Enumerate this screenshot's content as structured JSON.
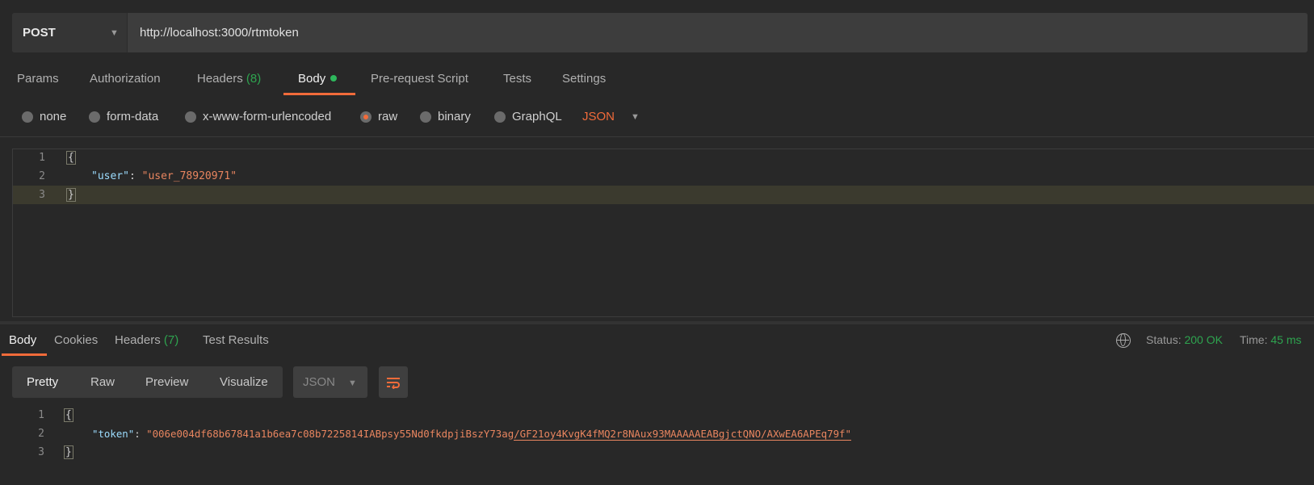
{
  "request": {
    "method": "POST",
    "url": "http://localhost:3000/rtmtoken"
  },
  "tabs": [
    {
      "label": "Params"
    },
    {
      "label": "Authorization"
    },
    {
      "label": "Headers",
      "count": "(8)"
    },
    {
      "label": "Body",
      "active": true
    },
    {
      "label": "Pre-request Script"
    },
    {
      "label": "Tests"
    },
    {
      "label": "Settings"
    }
  ],
  "body_types": [
    {
      "label": "none"
    },
    {
      "label": "form-data"
    },
    {
      "label": "x-www-form-urlencoded"
    },
    {
      "label": "raw",
      "selected": true
    },
    {
      "label": "binary"
    },
    {
      "label": "GraphQL"
    }
  ],
  "format": "JSON",
  "request_body": {
    "lines": [
      "1",
      "2",
      "3"
    ],
    "open": "{",
    "key": "\"user\"",
    "colon": ": ",
    "value": "\"user_78920971\"",
    "close": "}"
  },
  "response": {
    "tabs": [
      {
        "label": "Body",
        "active": true
      },
      {
        "label": "Cookies"
      },
      {
        "label": "Headers",
        "count": "(7)"
      },
      {
        "label": "Test Results"
      }
    ],
    "status_label": "Status:",
    "status": "200 OK",
    "time_label": "Time:",
    "time": "45 ms",
    "views": [
      "Pretty",
      "Raw",
      "Preview",
      "Visualize"
    ],
    "format": "JSON",
    "lines": [
      "1",
      "2",
      "3"
    ],
    "open": "{",
    "key": "\"token\"",
    "colon": ": ",
    "value_part1": "\"006e004df68b67841a1b6ea7c08b7225814IABpsy55Nd0fkdpjiBszY73ag",
    "value_part2": "/GF21oy4KvgK4fMQ2r8NAux93MAAAAAEABgjctQNO/AXwEA6APEq79f\"",
    "close": "}"
  },
  "colors": {
    "accent": "#f26b3a",
    "success": "#2ea44f",
    "background": "#282828"
  }
}
